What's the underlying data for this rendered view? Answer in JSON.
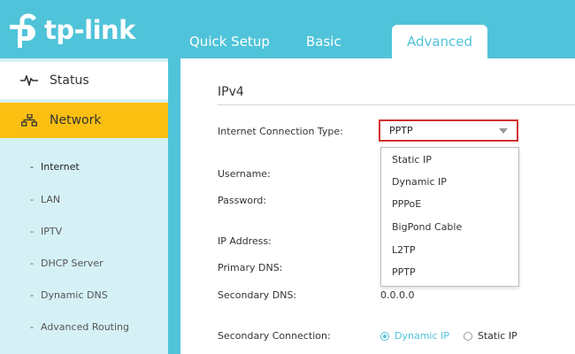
{
  "brand": {
    "name": "tp-link"
  },
  "tabs": [
    {
      "label": "Quick Setup"
    },
    {
      "label": "Basic"
    },
    {
      "label": "Advanced"
    }
  ],
  "sidebar": {
    "items": [
      {
        "label": "Status",
        "icon": "pulse-icon"
      },
      {
        "label": "Network",
        "icon": "network-topology-icon"
      }
    ],
    "subitems": [
      "Internet",
      "LAN",
      "IPTV",
      "DHCP Server",
      "Dynamic DNS",
      "Advanced Routing"
    ]
  },
  "main": {
    "section_title": "IPv4",
    "labels": {
      "connection_type": "Internet Connection Type:",
      "username": "Username:",
      "password": "Password:",
      "ip_address": "IP Address:",
      "primary_dns": "Primary DNS:",
      "secondary_dns": "Secondary DNS:",
      "secondary_connection": "Secondary Connection:"
    },
    "connection_type_value": "PPTP",
    "dropdown_options": [
      "Static IP",
      "Dynamic IP",
      "PPPoE",
      "BigPond Cable",
      "L2TP",
      "PPTP"
    ],
    "secondary_dns_value": "0.0.0.0",
    "secondary_connection": {
      "options": [
        "Dynamic IP",
        "Static IP"
      ],
      "selected": "Dynamic IP"
    }
  },
  "colors": {
    "brand": "#4fc3d9",
    "highlight": "#fbbf12",
    "select_border": "#d32f2f",
    "sidebar_bg": "#d5f1f6"
  }
}
